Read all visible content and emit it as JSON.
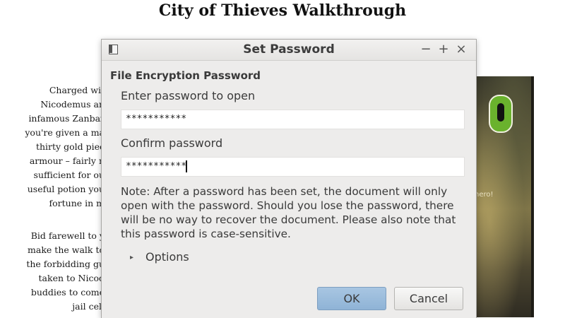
{
  "document": {
    "title": "City of Thieves Walkthrough",
    "paragraph1": [
      "Charged wit",
      "Nicodemus an",
      "infamous Zanbar",
      "you're given a ma",
      "thirty gold piec",
      "armour – fairly n",
      "sufficient for ou",
      "useful potion you",
      "fortune in m"
    ],
    "paragraph2": [
      "Bid farewell to y",
      "make the walk to",
      "the forbidding gu",
      "taken to Nicod",
      "buddies to come",
      "jail cell"
    ],
    "book_caption": "hero!"
  },
  "dialog": {
    "title": "Set Password",
    "window_controls": {
      "minimize": "−",
      "maximize": "+",
      "close": "×"
    },
    "section_title": "File Encryption Password",
    "password_label": "Enter password to open",
    "password_value": "***********",
    "confirm_label": "Confirm password",
    "confirm_value": "***********",
    "note": "Note: After a password has been set, the document will only open with the password. Should you lose the password, there will be no way to recover the document. Please also note that this password is case-sensitive.",
    "options_label": "Options",
    "ok_label": "OK",
    "cancel_label": "Cancel"
  },
  "colors": {
    "dialog_background": "#edeceb",
    "ok_button": "#a8c6e2",
    "book_logo": "#6ab22d"
  },
  "icons": {
    "window_icon": "document-window-icon",
    "options_expander": "triangle-right-icon",
    "book_logo": "puffin-logo-icon"
  }
}
